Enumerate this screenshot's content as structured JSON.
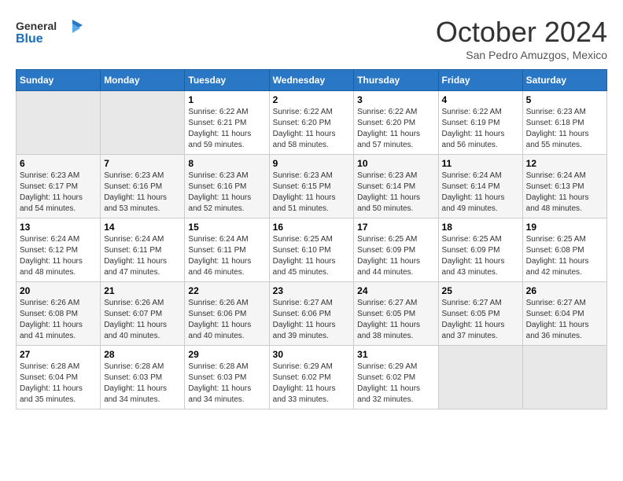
{
  "header": {
    "logo_general": "General",
    "logo_blue": "Blue",
    "month": "October 2024",
    "location": "San Pedro Amuzgos, Mexico"
  },
  "days_of_week": [
    "Sunday",
    "Monday",
    "Tuesday",
    "Wednesday",
    "Thursday",
    "Friday",
    "Saturday"
  ],
  "weeks": [
    [
      {
        "day": "",
        "info": ""
      },
      {
        "day": "",
        "info": ""
      },
      {
        "day": "1",
        "info": "Sunrise: 6:22 AM\nSunset: 6:21 PM\nDaylight: 11 hours and 59 minutes."
      },
      {
        "day": "2",
        "info": "Sunrise: 6:22 AM\nSunset: 6:20 PM\nDaylight: 11 hours and 58 minutes."
      },
      {
        "day": "3",
        "info": "Sunrise: 6:22 AM\nSunset: 6:20 PM\nDaylight: 11 hours and 57 minutes."
      },
      {
        "day": "4",
        "info": "Sunrise: 6:22 AM\nSunset: 6:19 PM\nDaylight: 11 hours and 56 minutes."
      },
      {
        "day": "5",
        "info": "Sunrise: 6:23 AM\nSunset: 6:18 PM\nDaylight: 11 hours and 55 minutes."
      }
    ],
    [
      {
        "day": "6",
        "info": "Sunrise: 6:23 AM\nSunset: 6:17 PM\nDaylight: 11 hours and 54 minutes."
      },
      {
        "day": "7",
        "info": "Sunrise: 6:23 AM\nSunset: 6:16 PM\nDaylight: 11 hours and 53 minutes."
      },
      {
        "day": "8",
        "info": "Sunrise: 6:23 AM\nSunset: 6:16 PM\nDaylight: 11 hours and 52 minutes."
      },
      {
        "day": "9",
        "info": "Sunrise: 6:23 AM\nSunset: 6:15 PM\nDaylight: 11 hours and 51 minutes."
      },
      {
        "day": "10",
        "info": "Sunrise: 6:23 AM\nSunset: 6:14 PM\nDaylight: 11 hours and 50 minutes."
      },
      {
        "day": "11",
        "info": "Sunrise: 6:24 AM\nSunset: 6:14 PM\nDaylight: 11 hours and 49 minutes."
      },
      {
        "day": "12",
        "info": "Sunrise: 6:24 AM\nSunset: 6:13 PM\nDaylight: 11 hours and 48 minutes."
      }
    ],
    [
      {
        "day": "13",
        "info": "Sunrise: 6:24 AM\nSunset: 6:12 PM\nDaylight: 11 hours and 48 minutes."
      },
      {
        "day": "14",
        "info": "Sunrise: 6:24 AM\nSunset: 6:11 PM\nDaylight: 11 hours and 47 minutes."
      },
      {
        "day": "15",
        "info": "Sunrise: 6:24 AM\nSunset: 6:11 PM\nDaylight: 11 hours and 46 minutes."
      },
      {
        "day": "16",
        "info": "Sunrise: 6:25 AM\nSunset: 6:10 PM\nDaylight: 11 hours and 45 minutes."
      },
      {
        "day": "17",
        "info": "Sunrise: 6:25 AM\nSunset: 6:09 PM\nDaylight: 11 hours and 44 minutes."
      },
      {
        "day": "18",
        "info": "Sunrise: 6:25 AM\nSunset: 6:09 PM\nDaylight: 11 hours and 43 minutes."
      },
      {
        "day": "19",
        "info": "Sunrise: 6:25 AM\nSunset: 6:08 PM\nDaylight: 11 hours and 42 minutes."
      }
    ],
    [
      {
        "day": "20",
        "info": "Sunrise: 6:26 AM\nSunset: 6:08 PM\nDaylight: 11 hours and 41 minutes."
      },
      {
        "day": "21",
        "info": "Sunrise: 6:26 AM\nSunset: 6:07 PM\nDaylight: 11 hours and 40 minutes."
      },
      {
        "day": "22",
        "info": "Sunrise: 6:26 AM\nSunset: 6:06 PM\nDaylight: 11 hours and 40 minutes."
      },
      {
        "day": "23",
        "info": "Sunrise: 6:27 AM\nSunset: 6:06 PM\nDaylight: 11 hours and 39 minutes."
      },
      {
        "day": "24",
        "info": "Sunrise: 6:27 AM\nSunset: 6:05 PM\nDaylight: 11 hours and 38 minutes."
      },
      {
        "day": "25",
        "info": "Sunrise: 6:27 AM\nSunset: 6:05 PM\nDaylight: 11 hours and 37 minutes."
      },
      {
        "day": "26",
        "info": "Sunrise: 6:27 AM\nSunset: 6:04 PM\nDaylight: 11 hours and 36 minutes."
      }
    ],
    [
      {
        "day": "27",
        "info": "Sunrise: 6:28 AM\nSunset: 6:04 PM\nDaylight: 11 hours and 35 minutes."
      },
      {
        "day": "28",
        "info": "Sunrise: 6:28 AM\nSunset: 6:03 PM\nDaylight: 11 hours and 34 minutes."
      },
      {
        "day": "29",
        "info": "Sunrise: 6:28 AM\nSunset: 6:03 PM\nDaylight: 11 hours and 34 minutes."
      },
      {
        "day": "30",
        "info": "Sunrise: 6:29 AM\nSunset: 6:02 PM\nDaylight: 11 hours and 33 minutes."
      },
      {
        "day": "31",
        "info": "Sunrise: 6:29 AM\nSunset: 6:02 PM\nDaylight: 11 hours and 32 minutes."
      },
      {
        "day": "",
        "info": ""
      },
      {
        "day": "",
        "info": ""
      }
    ]
  ]
}
